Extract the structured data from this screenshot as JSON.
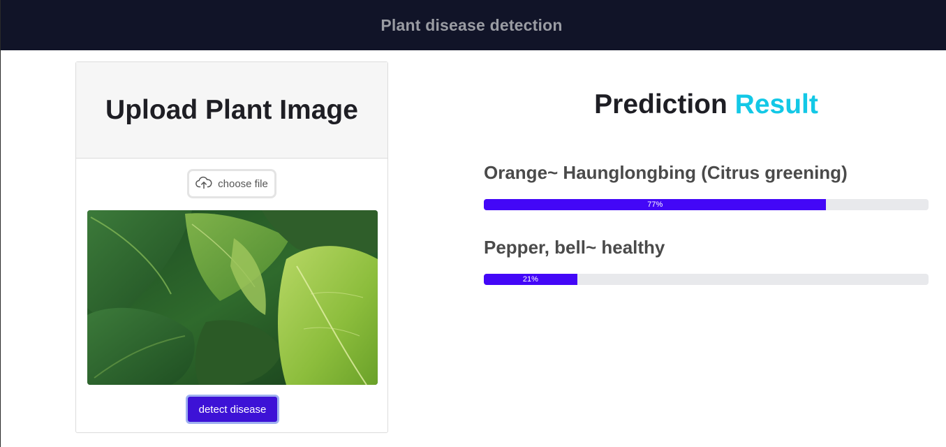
{
  "navbar": {
    "brand": "Plant disease detection"
  },
  "upload": {
    "title": "Upload Plant Image",
    "choose_file_label": "choose file",
    "detect_button_label": "detect disease"
  },
  "result": {
    "title_main": "Prediction",
    "title_accent": "Result",
    "predictions": [
      {
        "label": "Orange~ Haunglongbing (Citrus greening)",
        "percent": 77,
        "percent_text": "77%"
      },
      {
        "label": "Pepper, bell~ healthy",
        "percent": 21,
        "percent_text": "21%"
      }
    ]
  },
  "colors": {
    "navbar_bg": "#111428",
    "accent": "#13c8e6",
    "progress_fill": "#4307f7",
    "button_bg": "#3d12d6"
  },
  "icons": {
    "upload": "cloud-upload-icon"
  }
}
